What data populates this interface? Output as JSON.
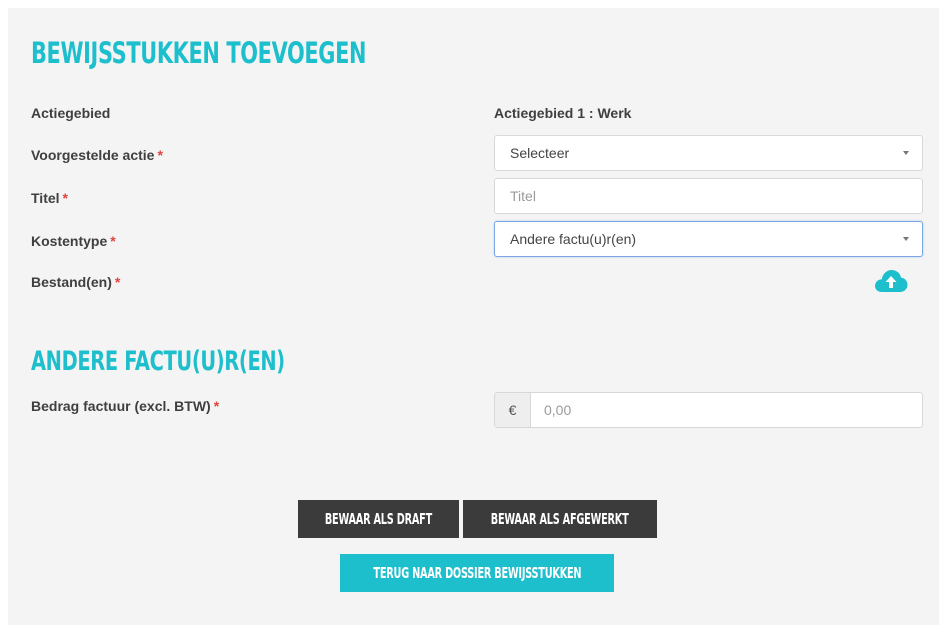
{
  "header": {
    "title": "Bewijsstukken toevoegen"
  },
  "form": {
    "actiegebied_label": "Actiegebied",
    "actiegebied_value": "Actiegebied 1 : Werk",
    "actie_label": "Voorgestelde actie",
    "actie_selected": "Selecteer",
    "titel_label": "Titel",
    "titel_placeholder": "Titel",
    "kostentype_label": "Kostentype",
    "kostentype_selected": "Andere factu(u)r(en)",
    "bestand_label": "Bestand(en)",
    "required_mark": "*"
  },
  "section2": {
    "title": "Andere factu(u)r(en)",
    "bedrag_label": "Bedrag factuur (excl. BTW)",
    "currency": "€",
    "bedrag_placeholder": "0,00"
  },
  "buttons": {
    "draft": "Bewaar als draft",
    "afgewerkt": "Bewaar als afgewerkt",
    "terug": "Terug naar dossier bewijsstukken"
  },
  "icons": {
    "upload": "cloud-upload-icon"
  },
  "colors": {
    "accent": "#1ebfcc",
    "dark_button": "#3b3b3b",
    "required": "#e0443e"
  }
}
